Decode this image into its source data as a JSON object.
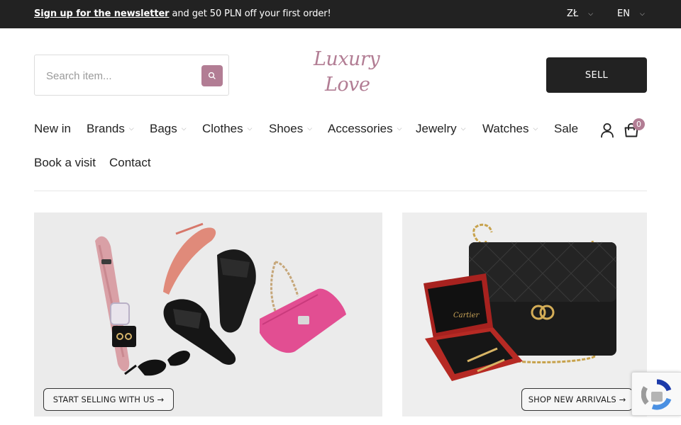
{
  "announcement": {
    "link_text": "Sign up for the newsletter",
    "rest_text": " and get 50 PLN off your first order!",
    "currency": "ZŁ",
    "language": "EN"
  },
  "search": {
    "placeholder": "Search item..."
  },
  "logo": {
    "line1": "Luxury",
    "line2": "Love"
  },
  "header": {
    "sell_label": "SELL",
    "cart_count": "0"
  },
  "nav": {
    "row1": [
      {
        "label": "New in",
        "has_dropdown": false
      },
      {
        "label": "Brands",
        "has_dropdown": true
      },
      {
        "label": "Bags",
        "has_dropdown": true
      },
      {
        "label": "Clothes",
        "has_dropdown": true
      },
      {
        "label": "Shoes",
        "has_dropdown": true
      },
      {
        "label": "Accessories",
        "has_dropdown": true
      },
      {
        "label": "Jewelry",
        "has_dropdown": true
      },
      {
        "label": "Watches",
        "has_dropdown": true
      },
      {
        "label": "Sale",
        "has_dropdown": false
      }
    ],
    "row2": [
      {
        "label": "Book a visit",
        "has_dropdown": false
      },
      {
        "label": "Contact",
        "has_dropdown": false
      }
    ]
  },
  "banners": [
    {
      "cta_label": "START SELLING WITH US →"
    },
    {
      "cta_label": "SHOP NEW ARRIVALS →",
      "box_brand": "Cartier"
    }
  ],
  "icons": {
    "search": "search-icon",
    "account": "user-icon",
    "cart": "shopping-bag-icon",
    "dropdown": "chevron-down-icon",
    "captcha": "recaptcha-icon"
  },
  "colors": {
    "accent": "#b27d94",
    "dark": "#222222",
    "topbar": "#222222"
  }
}
